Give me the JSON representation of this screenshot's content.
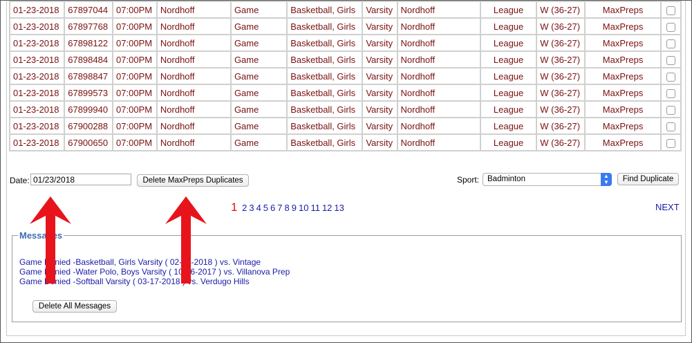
{
  "rows": [
    {
      "date": "01-23-2018",
      "id": "67897044",
      "time": "07:00PM",
      "location": "Nordhoff",
      "type": "Game",
      "sport": "Basketball, Girls",
      "level": "Varsity",
      "opponent": "Nordhoff",
      "category": "League",
      "result": "W (36-27)",
      "source": "MaxPreps"
    },
    {
      "date": "01-23-2018",
      "id": "67897768",
      "time": "07:00PM",
      "location": "Nordhoff",
      "type": "Game",
      "sport": "Basketball, Girls",
      "level": "Varsity",
      "opponent": "Nordhoff",
      "category": "League",
      "result": "W (36-27)",
      "source": "MaxPreps"
    },
    {
      "date": "01-23-2018",
      "id": "67898122",
      "time": "07:00PM",
      "location": "Nordhoff",
      "type": "Game",
      "sport": "Basketball, Girls",
      "level": "Varsity",
      "opponent": "Nordhoff",
      "category": "League",
      "result": "W (36-27)",
      "source": "MaxPreps"
    },
    {
      "date": "01-23-2018",
      "id": "67898484",
      "time": "07:00PM",
      "location": "Nordhoff",
      "type": "Game",
      "sport": "Basketball, Girls",
      "level": "Varsity",
      "opponent": "Nordhoff",
      "category": "League",
      "result": "W (36-27)",
      "source": "MaxPreps"
    },
    {
      "date": "01-23-2018",
      "id": "67898847",
      "time": "07:00PM",
      "location": "Nordhoff",
      "type": "Game",
      "sport": "Basketball, Girls",
      "level": "Varsity",
      "opponent": "Nordhoff",
      "category": "League",
      "result": "W (36-27)",
      "source": "MaxPreps"
    },
    {
      "date": "01-23-2018",
      "id": "67899573",
      "time": "07:00PM",
      "location": "Nordhoff",
      "type": "Game",
      "sport": "Basketball, Girls",
      "level": "Varsity",
      "opponent": "Nordhoff",
      "category": "League",
      "result": "W (36-27)",
      "source": "MaxPreps"
    },
    {
      "date": "01-23-2018",
      "id": "67899940",
      "time": "07:00PM",
      "location": "Nordhoff",
      "type": "Game",
      "sport": "Basketball, Girls",
      "level": "Varsity",
      "opponent": "Nordhoff",
      "category": "League",
      "result": "W (36-27)",
      "source": "MaxPreps"
    },
    {
      "date": "01-23-2018",
      "id": "67900288",
      "time": "07:00PM",
      "location": "Nordhoff",
      "type": "Game",
      "sport": "Basketball, Girls",
      "level": "Varsity",
      "opponent": "Nordhoff",
      "category": "League",
      "result": "W (36-27)",
      "source": "MaxPreps"
    },
    {
      "date": "01-23-2018",
      "id": "67900650",
      "time": "07:00PM",
      "location": "Nordhoff",
      "type": "Game",
      "sport": "Basketball, Girls",
      "level": "Varsity",
      "opponent": "Nordhoff",
      "category": "League",
      "result": "W (36-27)",
      "source": "MaxPreps"
    }
  ],
  "controls": {
    "date_label": "Date:",
    "date_value": "01/23/2018",
    "delete_dupes_label": "Delete MaxPreps Duplicates",
    "sport_label": "Sport:",
    "sport_value": "Badminton",
    "find_dupe_label": "Find Duplicate"
  },
  "pagination": {
    "current": "1",
    "pages": [
      "2",
      "3",
      "4",
      "5",
      "6",
      "7",
      "8",
      "9",
      "10",
      "11",
      "12",
      "13"
    ],
    "next_label": "NEXT"
  },
  "messages": {
    "legend": "Messages",
    "items": [
      "Game Denied -Basketball, Girls Varsity ( 02-14-2018 ) vs. Vintage",
      "Game Denied -Water Polo, Boys Varsity ( 10-26-2017 ) vs. Villanova Prep",
      "Game Denied -Softball Varsity ( 03-17-2018 ) vs. Verdugo Hills"
    ],
    "delete_all_label": "Delete All Messages"
  },
  "colors": {
    "row_text": "#7a1010",
    "link": "#1a1aa6",
    "current_page": "#e01010",
    "annotation_arrow": "#e8141c"
  }
}
